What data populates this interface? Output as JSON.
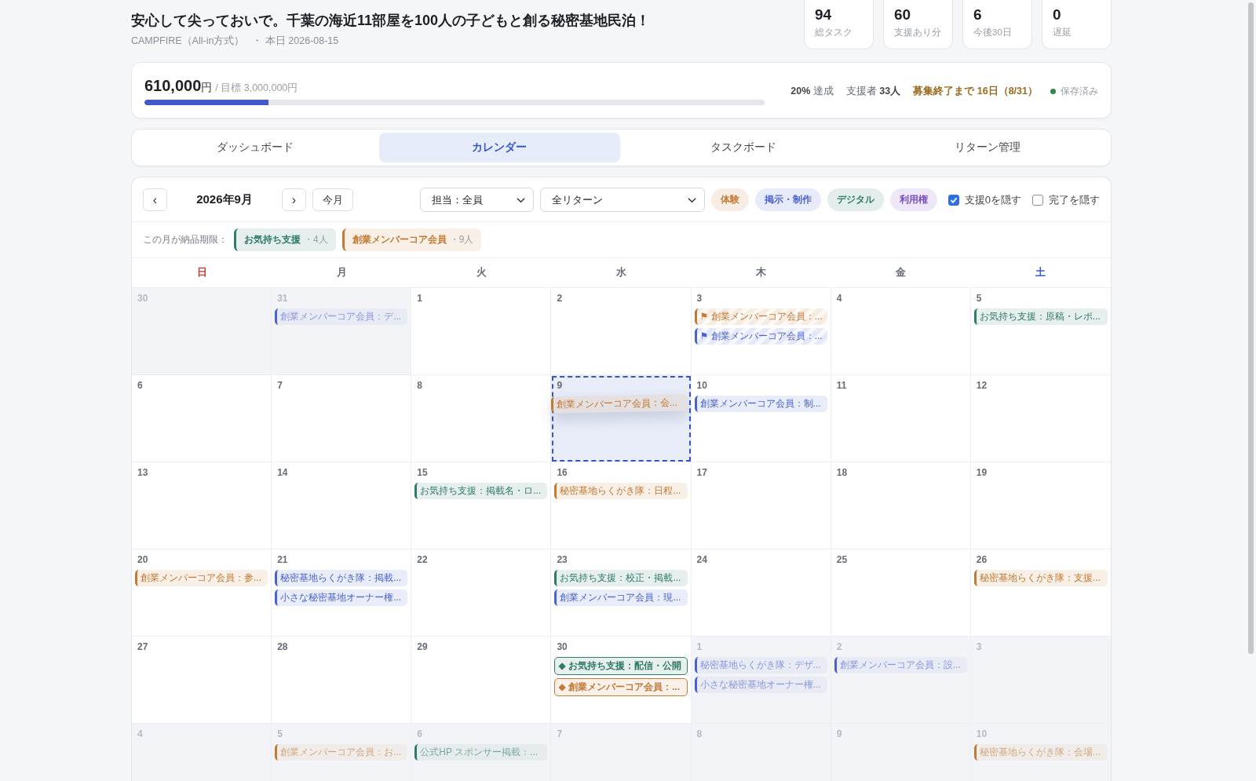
{
  "header": {
    "title": "安心して尖っておいで。千葉の海近11部屋を100人の子どもと創る秘密基地民泊！",
    "platform": "CAMPFIRE（All-in方式）",
    "today": "・ 本日 2026-08-15"
  },
  "stats": [
    {
      "value": "94",
      "label": "総タスク"
    },
    {
      "value": "60",
      "label": "支援あり分"
    },
    {
      "value": "6",
      "label": "今後30日"
    },
    {
      "value": "0",
      "label": "遅延"
    }
  ],
  "funding": {
    "amount": "610,000",
    "unit": "円",
    "goal": "/ 目標 3,000,000円",
    "level": 0.2,
    "achieved_value": "20%",
    "achieved_label": "達成",
    "backers_label": "支援者",
    "backers_value": "33人",
    "deadline_label": "募集終了まで",
    "deadline_value": "16日",
    "deadline_date": "（8/31）",
    "save_status": "保存済み"
  },
  "tabs": [
    {
      "label": "ダッシュボード",
      "selected": false
    },
    {
      "label": "カレンダー",
      "selected": true
    },
    {
      "label": "タスクボード",
      "selected": false
    },
    {
      "label": "リターン管理",
      "selected": false
    }
  ],
  "calendar": {
    "prev": "‹",
    "month": "2026年9月",
    "next": "›",
    "today_button": "今月",
    "assignee_select": "担当：全員",
    "return_select": "全リターン",
    "category_chips": [
      {
        "label": "体験",
        "color": "#c27a34"
      },
      {
        "label": "掲示・制作",
        "color": "#4a63d0"
      },
      {
        "label": "デジタル",
        "color": "#2f7a68"
      },
      {
        "label": "利用権",
        "color": "#7a4cc0"
      }
    ],
    "checkboxes": [
      {
        "label": "支援0を隠す",
        "checked": true
      },
      {
        "label": "完了を隠す",
        "checked": false
      }
    ],
    "deadline_label": "この月が納品期限：",
    "deadline_chips": [
      {
        "name": "お気持ち支援",
        "count": "・4人",
        "color": "#2f7a68"
      },
      {
        "name": "創業メンバーコア会員",
        "count": "・9人",
        "color": "#c27a34"
      }
    ],
    "weekdays": [
      {
        "label": "日",
        "color": "#c0392b"
      },
      {
        "label": "月",
        "color": "#666b75"
      },
      {
        "label": "火",
        "color": "#666b75"
      },
      {
        "label": "水",
        "color": "#666b75"
      },
      {
        "label": "木",
        "color": "#666b75"
      },
      {
        "label": "金",
        "color": "#666b75"
      },
      {
        "label": "土",
        "color": "#3b5bcc"
      }
    ],
    "weeks": [
      {
        "days": [
          {
            "day": "30",
            "in_month": false
          },
          {
            "day": "31",
            "in_month": false,
            "events": [
              {
                "text": "創業メンバーコア会員：デ...",
                "kind": "normal",
                "color": "#4a63d0"
              }
            ]
          },
          {
            "day": "1",
            "in_month": true
          },
          {
            "day": "2",
            "in_month": true
          },
          {
            "day": "3",
            "in_month": true,
            "events": [
              {
                "text": "⚑ 創業メンバーコア会員：...",
                "kind": "flagged",
                "color": "#c27a34"
              },
              {
                "text": "⚑ 創業メンバーコア会員：...",
                "kind": "flagged",
                "color": "#4a63d0"
              }
            ]
          },
          {
            "day": "4",
            "in_month": true
          },
          {
            "day": "5",
            "in_month": true,
            "events": [
              {
                "text": "お気持ち支援：原稿・レポ...",
                "kind": "normal",
                "color": "#2f7a68"
              }
            ]
          }
        ]
      },
      {
        "days": [
          {
            "day": "6",
            "in_month": true
          },
          {
            "day": "7",
            "in_month": true
          },
          {
            "day": "8",
            "in_month": true
          },
          {
            "day": "9",
            "in_month": true,
            "drop_target": true,
            "events": [
              {
                "text": "創業メンバーコア会員：会...",
                "kind": "dragging",
                "color": "#c27a34"
              }
            ]
          },
          {
            "day": "10",
            "in_month": true,
            "events": [
              {
                "text": "創業メンバーコア会員：制...",
                "kind": "normal",
                "color": "#4a63d0"
              }
            ]
          },
          {
            "day": "11",
            "in_month": true
          },
          {
            "day": "12",
            "in_month": true
          }
        ]
      },
      {
        "days": [
          {
            "day": "13",
            "in_month": true
          },
          {
            "day": "14",
            "in_month": true
          },
          {
            "day": "15",
            "in_month": true,
            "events": [
              {
                "text": "お気持ち支援：掲載名・ロ...",
                "kind": "normal",
                "color": "#2f7a68"
              }
            ]
          },
          {
            "day": "16",
            "in_month": true,
            "events": [
              {
                "text": "秘密基地らくがき隊：日程...",
                "kind": "normal",
                "color": "#c27a34"
              }
            ]
          },
          {
            "day": "17",
            "in_month": true
          },
          {
            "day": "18",
            "in_month": true
          },
          {
            "day": "19",
            "in_month": true
          }
        ]
      },
      {
        "days": [
          {
            "day": "20",
            "in_month": true,
            "events": [
              {
                "text": "創業メンバーコア会員：参...",
                "kind": "normal",
                "color": "#c27a34"
              }
            ]
          },
          {
            "day": "21",
            "in_month": true,
            "events": [
              {
                "text": "秘密基地らくがき隊：掲載...",
                "kind": "normal",
                "color": "#4a63d0"
              },
              {
                "text": "小さな秘密基地オーナー権...",
                "kind": "normal",
                "color": "#4a63d0"
              }
            ]
          },
          {
            "day": "22",
            "in_month": true
          },
          {
            "day": "23",
            "in_month": true,
            "events": [
              {
                "text": "お気持ち支援：校正・掲載...",
                "kind": "normal",
                "color": "#2f7a68"
              },
              {
                "text": "創業メンバーコア会員：現...",
                "kind": "normal",
                "color": "#4a63d0"
              }
            ]
          },
          {
            "day": "24",
            "in_month": true
          },
          {
            "day": "25",
            "in_month": true
          },
          {
            "day": "26",
            "in_month": true,
            "events": [
              {
                "text": "秘密基地らくがき隊：支援...",
                "kind": "normal",
                "color": "#c27a34"
              }
            ]
          }
        ]
      },
      {
        "days": [
          {
            "day": "27",
            "in_month": true
          },
          {
            "day": "28",
            "in_month": true
          },
          {
            "day": "29",
            "in_month": true
          },
          {
            "day": "30",
            "in_month": true,
            "events": [
              {
                "text": "◆ お気持ち支援：配信・公開",
                "kind": "milestone",
                "color": "#2f7a68"
              },
              {
                "text": "◆ 創業メンバーコア会員：...",
                "kind": "milestone",
                "color": "#c27a34"
              }
            ]
          },
          {
            "day": "1",
            "in_month": false,
            "events": [
              {
                "text": "秘密基地らくがき隊：デザ...",
                "kind": "normal",
                "color": "#4a63d0"
              },
              {
                "text": "小さな秘密基地オーナー権...",
                "kind": "normal",
                "color": "#4a63d0"
              }
            ]
          },
          {
            "day": "2",
            "in_month": false,
            "events": [
              {
                "text": "創業メンバーコア会員：設...",
                "kind": "normal",
                "color": "#4a63d0"
              }
            ]
          },
          {
            "day": "3",
            "in_month": false
          }
        ]
      },
      {
        "days": [
          {
            "day": "4",
            "in_month": false
          },
          {
            "day": "5",
            "in_month": false,
            "events": [
              {
                "text": "創業メンバーコア会員：お...",
                "kind": "normal",
                "color": "#c27a34"
              }
            ]
          },
          {
            "day": "6",
            "in_month": false,
            "events": [
              {
                "text": "公式HP スポンサー掲載：...",
                "kind": "normal",
                "color": "#2f7a68"
              }
            ]
          },
          {
            "day": "7",
            "in_month": false
          },
          {
            "day": "8",
            "in_month": false
          },
          {
            "day": "9",
            "in_month": false
          },
          {
            "day": "10",
            "in_month": false,
            "events": [
              {
                "text": "秘密基地らくがき隊：会場...",
                "kind": "normal",
                "color": "#c27a34"
              }
            ]
          }
        ]
      }
    ]
  }
}
